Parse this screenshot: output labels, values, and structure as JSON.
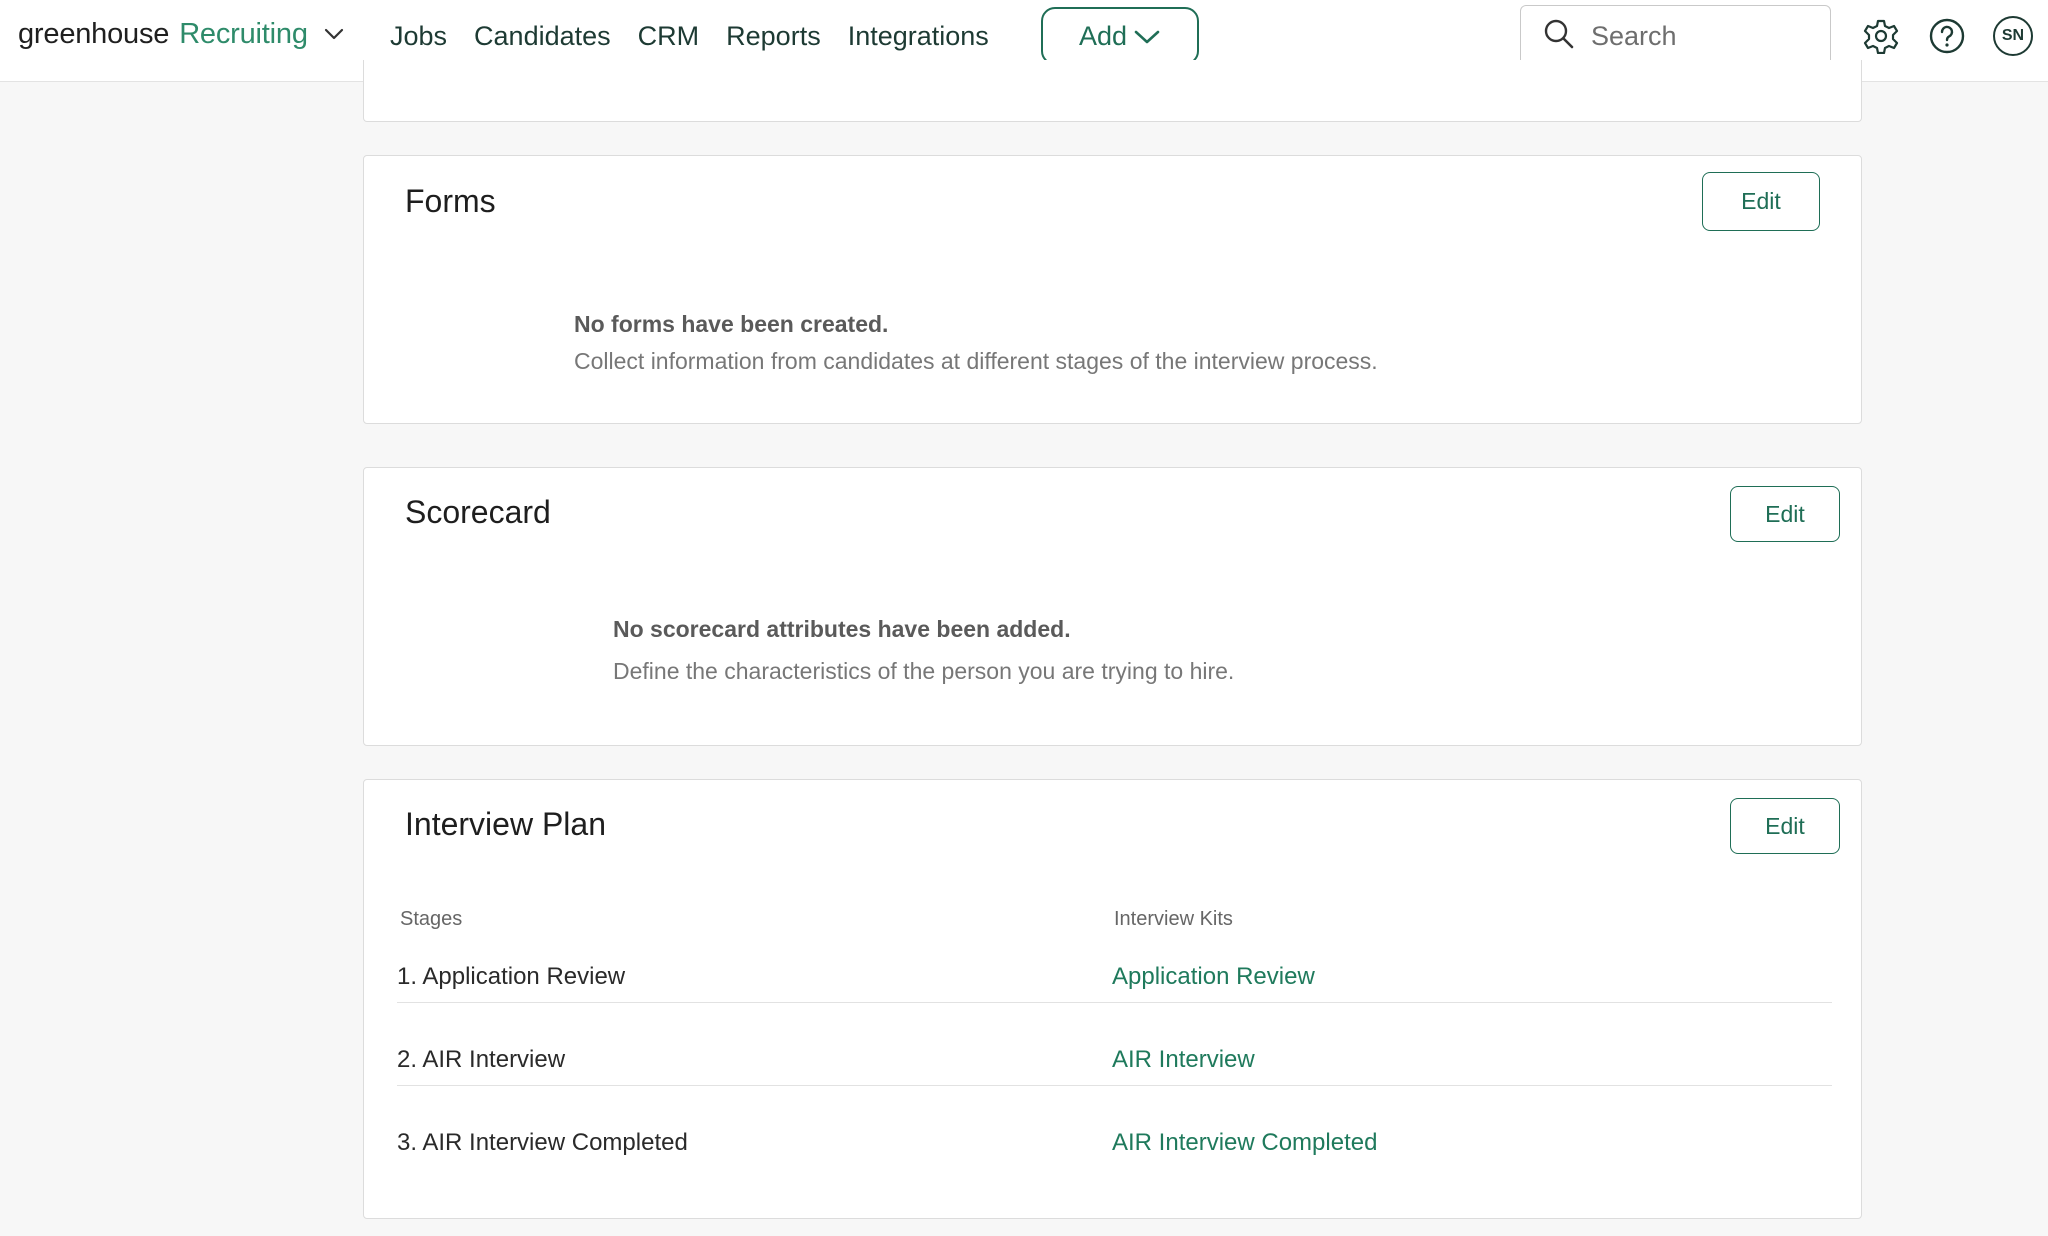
{
  "header": {
    "brand": "greenhouse",
    "product": "Recruiting",
    "nav": [
      "Jobs",
      "Candidates",
      "CRM",
      "Reports",
      "Integrations"
    ],
    "add_label": "Add",
    "search_placeholder": "Search",
    "avatar_initials": "SN",
    "icons": [
      "chevron-down-icon",
      "search-icon",
      "gear-icon",
      "help-icon"
    ]
  },
  "forms": {
    "title": "Forms",
    "edit_label": "Edit",
    "empty_title": "No forms have been created.",
    "empty_desc": "Collect information from candidates at different stages of the interview process."
  },
  "scorecard": {
    "title": "Scorecard",
    "edit_label": "Edit",
    "empty_title": "No scorecard attributes have been added.",
    "empty_desc": "Define the characteristics of the person you are trying to hire."
  },
  "interview_plan": {
    "title": "Interview Plan",
    "edit_label": "Edit",
    "columns": {
      "stages": "Stages",
      "kits": "Interview Kits"
    },
    "rows": [
      {
        "stage": "1. Application Review",
        "kit": "Application Review"
      },
      {
        "stage": "2. AIR Interview",
        "kit": "AIR Interview"
      },
      {
        "stage": "3. AIR Interview Completed",
        "kit": "AIR Interview Completed"
      }
    ]
  },
  "colors": {
    "accent": "#1f6e56",
    "link": "#1f7a5c",
    "brand_product": "#2e8b6a"
  }
}
